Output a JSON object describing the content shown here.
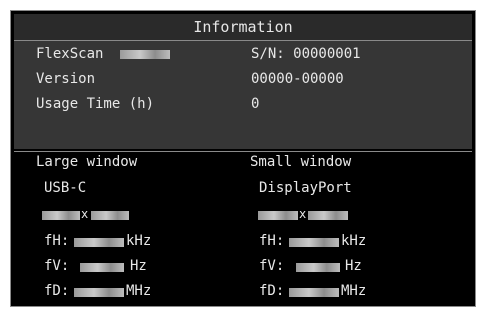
{
  "title": "Information",
  "info": {
    "model_label": "FlexScan",
    "serial_label": "S/N: 00000001",
    "version_label": "Version",
    "version_value": "00000-00000",
    "usage_label": "Usage Time (h)",
    "usage_value": "0"
  },
  "large_window": {
    "heading": "Large window",
    "input": "USB-C",
    "resolution_sep": "x",
    "fh_label": "fH:",
    "fh_unit": "kHz",
    "fv_label": "fV:",
    "fv_unit": "Hz",
    "fd_label": "fD:",
    "fd_unit": "MHz"
  },
  "small_window": {
    "heading": "Small window",
    "input": "DisplayPort",
    "resolution_sep": "x",
    "fh_label": "fH:",
    "fh_unit": "kHz",
    "fv_label": "fV:",
    "fv_unit": "Hz",
    "fd_label": "fD:",
    "fd_unit": "MHz"
  }
}
